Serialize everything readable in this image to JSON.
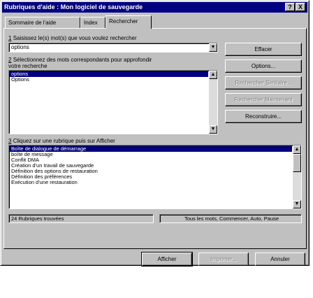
{
  "window": {
    "title": "Rubriques d'aide : Mon logiciel de sauvegarde",
    "help_btn": "?",
    "close_btn": "X"
  },
  "tabs": [
    {
      "label": "Sommaire de l'aide"
    },
    {
      "label": "Index"
    },
    {
      "label": "Rechercher"
    }
  ],
  "step1": {
    "num": "1",
    "label": "Saisissez le(s) mot(s) que vous voulez rechercher",
    "value": "options"
  },
  "step2": {
    "num": "2",
    "label_line1": "Sélectionnez des mots correspondants pour approfondir",
    "label_line2": "votre recherche",
    "items": [
      "options",
      "Options"
    ]
  },
  "step3": {
    "num": "3",
    "label": "Cliquez sur une rubrique puis sur Afficher",
    "items": [
      "Boîte de dialogue de démarrage",
      "boîte de message",
      "Conflit DMA",
      "Création d'un travail de sauvegarde",
      "Définition des options de restauration",
      "Définition des préférences",
      "Exécution d'une restauration"
    ]
  },
  "side_buttons": {
    "effacer": "Effacer",
    "options": "Options...",
    "similaire": "Rechercher Similaire...",
    "maintenant": "Rechercher Maintenant",
    "reconstruire": "Reconstruire..."
  },
  "status": {
    "count": "24 Rubriques trouvées",
    "mode": "Tous les mots, Commencer, Auto, Pause"
  },
  "bottom_buttons": {
    "afficher": "Afficher",
    "imprimer": "Imprimer...",
    "annuler": "Annuler"
  },
  "icons": {
    "dropdown": "chevron-down-icon",
    "scroll_up": "arrow-up-icon",
    "scroll_down": "arrow-down-icon"
  }
}
